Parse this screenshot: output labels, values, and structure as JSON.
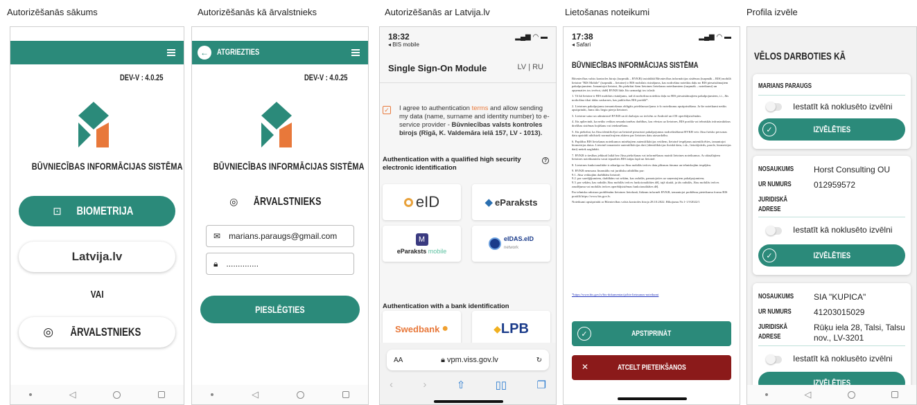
{
  "captions": [
    "Autorizēšanās sākums",
    "Autorizēšanās kā ārvalstnieks",
    "Autorizēšanās ar Latvija.lv",
    "Lietošanas noteikumi",
    "Profila izvēle"
  ],
  "s1": {
    "version": "DEV-V : 4.0.25",
    "system_title": "BŪVNIECĪBAS INFORMĀCIJAS SISTĒMA",
    "biometry": "BIOMETRIJA",
    "latvija": "Latvija.lv",
    "or": "VAI",
    "foreigner": "ĀRVALSTNIEKS"
  },
  "s2": {
    "back": "ATGRIEZTIES",
    "version": "DEV-V : 4.0.25",
    "system_title": "BŪVNIECĪBAS INFORMĀCIJAS SISTĒMA",
    "heading": "ĀRVALSTNIEKS",
    "email": "marians.paraugs@gmail.com",
    "password": "..............",
    "connect": "PIESLĒGTIES"
  },
  "s3": {
    "time": "18:32",
    "back_app": "◂ BIS mobile",
    "title": "Single Sign-On Module",
    "lang_lv": "LV",
    "lang_sep": "|",
    "lang_ru": "RU",
    "consent_a": "I agree to authentication ",
    "consent_terms": "terms",
    "consent_b": " and allow sending my data (name, surname and identity number) to e-service provider - ",
    "consent_bold": "Būvniecības valsts kontroles birojs (Rīgā, K. Valdemāra ielā 157, LV - 1013).",
    "section1": "Authentication with a qualified high security electronic identification",
    "help": "?",
    "eid": "eID",
    "eparaksts": "eParaksts",
    "eparaksts_mobile_a": "eParaksts",
    "eparaksts_mobile_b": "mobile",
    "eidas_a": "eIDAS.eID",
    "eidas_b": "network",
    "section2": "Authentication with a bank identification",
    "swedbank": "Swedbank",
    "lpb": "LPB",
    "aa": "AA",
    "url": "vpm.viss.gov.lv"
  },
  "s4": {
    "time": "17:38",
    "back_app": "◂ Safari",
    "title": "BŪVNIECĪBAS INFORMĀCIJAS SISTĒMA",
    "paragraphs": [
      "Būvniecības valsts kontroles birojs (turpmāk – BVKB) izstrādātā Būvniecības informācijas sistēmas (turpmāk – BIS) mobilā lietotne \"BIS Mobile\" (turpmāk – lietotne) ir BIS mobilais risinājums, kas nodrošina noteiktu daļu no BIS piesaistāmajiem pakalpojumiem. Izmantojot lietotni, Jūs piekrītat šiem lietotnes lietošanas noteikumiem (turpmāk – noteikumi) un apņematies tos ievērot, tādēļ BVKB lūdz Jūs uzmanīgi tos izlasīt:",
      "1. Tā kā lietotne ir BIS mobilais risinājums, tad tā nodrošina noteiktu daļu no BIS piesaistāmajiem pakalpojumiem, t.i., Jūs nodrošina tikai tādas saskarnes, kas publicētas BIS portālā*.",
      "2. Lietotnes pakalpojumu izmantošanas obligāts priekšnosacījums ir šo noteikumu apstiprināšana. Ja šie noteikumi netiks apstiprināti, Jums tiks liegta pieeja lietotnei.",
      "3. Lietotne satur un administrē BVKB un tā darbojas uz ierīcēm ar Android un iOS operētājsistēmām.",
      "4. Jūs apliecināt, ka netiks veiktas nesankcionētas darbības, kas vērstas uz lietotnes, BIS portāla vai tehniskās infrastruktūras drošības sistēmas bojāšanu vai ietekmēšanu.",
      "5. Jūs piekrītat, ka Jūsu identificējot un lietotnē piesaistot pakalpojumus nodrošināšanai BVKB veic Jūsu fizisko personas datu apstrādi atbilstoši normatīvajiem aktiem par lietotnes datu aizsardzību.",
      "6. Papildus BIS lietošanas noteikumos minētajiem autentifikācijas veidiem, lietotnē iespējams autentificēties, izmantojot biometrijas datus. Lietotnē izmantotie autentifikācijas dati (identifikācijas fiziskā datu, t.sk., lietotājvārds, parole, biometrijas dati) netiek uzglabāti.",
      "7. BVKB ir tiesības jebkurā laikā bez Jūsu piekrišanas vai informēšanas mainīt lietotnes noteikumus. Ar aktuālajiem lietotnes noteikumiem varat iepazīties BIS mājas lapā un lietotnē.",
      "8. Lietotnes funkcionalitāte ir atkarīga no Jūsu mobilās ierīces datu plūsmas ātruma un tehniskajām iespējām.",
      "9. BVKB nenosaus finansiālu vai juridisku atbildību par:\n9.1. Jūsu veiktajām darbībām lietotnē;\n9.2. par sarežģījumiem, darbībām vai sekām, kas radušās, pamatojoties uz saņemtajiem pakalpojumiem;\n9.3. par sekām, kas radušās Jūsu mobilās ierīces funkcionalitātes dēļ, tajā skaitā, ja tās radušās, Jūsu mobilās ierīces zaudējuma vai mobilās ierīces operētājsistēmas funkcionalitātes dēļ.",
      "Par tehniska rakstura problēmām lietotnes lietošanā, lūdzam informēt BVKB, izmantojot problēmu pieteikuma formu BIS portālā https://www.bis.gov.lv.",
      "Noteikumi apstiprināti ar Būvniecības valsts kontroles biroja 28.10.2022. Rīkojumu Nr.1-1.9/2022/1"
    ],
    "link": "*https://www.bis.gov.lv/bis-dokumentacija/bis-lietosanas-noteikumi",
    "approve": "APSTIPRINĀT",
    "cancel": "ATCELT PIETEIKŠANOS"
  },
  "s5": {
    "heading": "VĒLOS DARBOTIES KĀ",
    "person": "MARIANS PARAUGS",
    "default_label": "Iestatīt kā noklusēto izvēlni",
    "choose": "IZVĒLĒTIES",
    "lbl_name": "NOSAUKUMS",
    "lbl_reg": "UR NUMURS",
    "lbl_addr_a": "JURIDISKĀ",
    "lbl_addr_b": "ADRESE",
    "org1": {
      "name": "Horst Consulting OU",
      "reg": "012959572",
      "addr": ""
    },
    "org2": {
      "name": "SIA \"KUPICA\"",
      "reg": "41203015029",
      "addr_a": "Rūķu iela 28, Talsi, Talsu",
      "addr_b": "nov., LV-3201"
    }
  },
  "colors": {
    "teal": "#2b8a7a",
    "orange": "#e8783a",
    "red": "#8b1a1a"
  }
}
